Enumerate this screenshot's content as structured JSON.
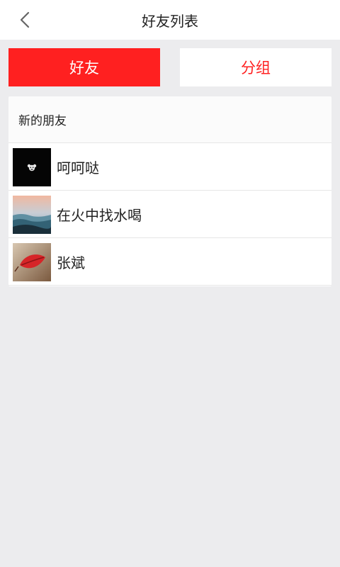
{
  "colors": {
    "accent": "#ff2020"
  },
  "header": {
    "title": "好友列表",
    "back_icon": "chevron-left-icon"
  },
  "tabs": {
    "friends": "好友",
    "groups": "分组"
  },
  "list": {
    "new_friends_label": "新的朋友",
    "friends": [
      {
        "name": "呵呵哒",
        "avatar": "black-bear-avatar"
      },
      {
        "name": "在火中找水喝",
        "avatar": "seascape-avatar"
      },
      {
        "name": "张斌",
        "avatar": "red-leaf-avatar"
      }
    ]
  }
}
